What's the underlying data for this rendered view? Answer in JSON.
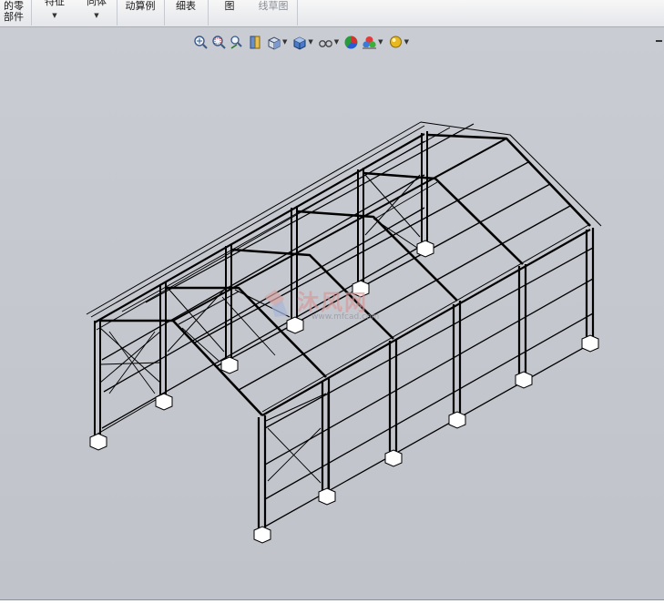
{
  "ribbon": {
    "items": [
      {
        "line1": "装配体中装配的零",
        "line2": "部件",
        "visible1": "的零",
        "visible2": "部件"
      },
      {
        "label": "特征",
        "dropdown": true
      },
      {
        "label": "同体",
        "dropdown": true
      },
      {
        "label": "动算例"
      },
      {
        "label": "细表"
      },
      {
        "label": "图"
      },
      {
        "label": "线草图",
        "disabled": true
      }
    ]
  },
  "heads_up_toolbar": {
    "icons": [
      "zoom-to-fit-icon",
      "zoom-to-area-icon",
      "previous-view-icon",
      "section-view-icon",
      "view-orientation-icon",
      "display-style-icon",
      "hide-show-items-icon",
      "edit-appearance-icon",
      "apply-scene-icon",
      "view-settings-icon"
    ]
  },
  "watermark": {
    "text": "沐风网",
    "url": "www.mfcad.com"
  }
}
